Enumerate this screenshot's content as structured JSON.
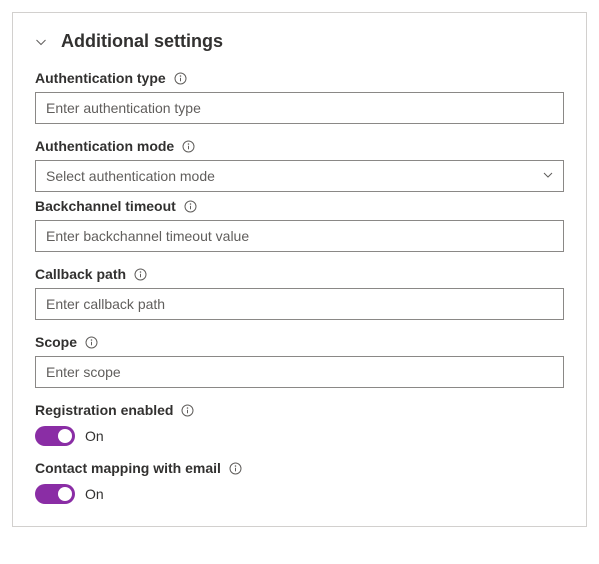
{
  "section": {
    "title": "Additional settings"
  },
  "fields": {
    "authType": {
      "label": "Authentication type",
      "placeholder": "Enter authentication type"
    },
    "authMode": {
      "label": "Authentication mode",
      "placeholder": "Select authentication mode"
    },
    "backchannel": {
      "label": "Backchannel timeout",
      "placeholder": "Enter backchannel timeout value"
    },
    "callback": {
      "label": "Callback path",
      "placeholder": "Enter callback path"
    },
    "scope": {
      "label": "Scope",
      "placeholder": "Enter scope"
    },
    "registration": {
      "label": "Registration enabled",
      "state": "On"
    },
    "contactMapping": {
      "label": "Contact mapping with email",
      "state": "On"
    }
  },
  "colors": {
    "accent": "#8a2da5",
    "border": "#8a8886"
  }
}
